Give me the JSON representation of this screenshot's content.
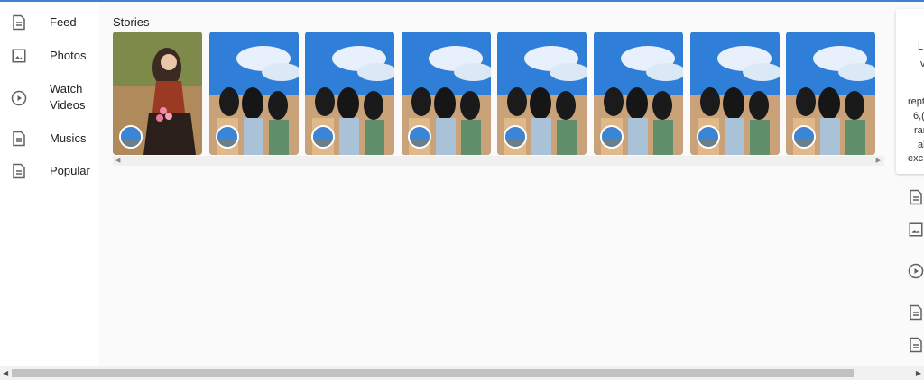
{
  "nav": {
    "items": [
      {
        "label": "Feed",
        "icon": "document-icon"
      },
      {
        "label": "Photos",
        "icon": "image-icon"
      },
      {
        "label": "Watch Videos",
        "icon": "play-circle-icon"
      },
      {
        "label": "Musics",
        "icon": "document-icon"
      },
      {
        "label": "Popular",
        "icon": "document-icon"
      }
    ]
  },
  "stories": {
    "title": "Stories",
    "count": 8
  },
  "right_panel": {
    "snippets": [
      "L",
      "v",
      "rept",
      "6,(",
      "rar",
      "al",
      "exc"
    ],
    "icons": [
      "document-icon",
      "image-icon",
      "play-circle-icon",
      "document-icon",
      "document-icon"
    ]
  },
  "colors": {
    "accent": "#3f80d6",
    "sky": "#2f7fd8",
    "page_bg": "#fafafa"
  }
}
